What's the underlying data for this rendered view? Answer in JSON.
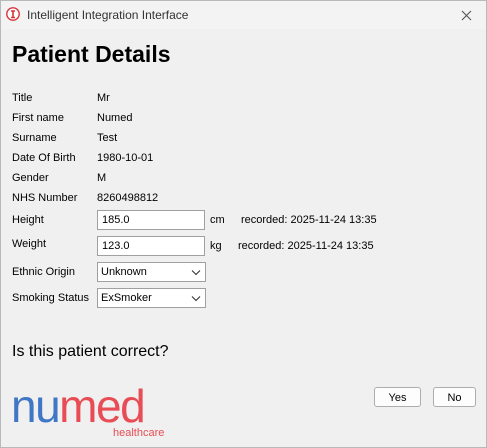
{
  "window": {
    "title": "Intelligent Integration Interface"
  },
  "page_title": "Patient Details",
  "fields": {
    "title": {
      "label": "Title",
      "value": "Mr"
    },
    "first_name": {
      "label": "First name",
      "value": "Numed"
    },
    "surname": {
      "label": "Surname",
      "value": "Test"
    },
    "dob": {
      "label": "Date Of Birth",
      "value": "1980-10-01"
    },
    "gender": {
      "label": "Gender",
      "value": "M"
    },
    "nhs_number": {
      "label": "NHS Number",
      "value": "8260498812"
    }
  },
  "height": {
    "label": "Height",
    "value": "185.0",
    "unit": "cm",
    "recorded": "recorded: 2025-11-24 13:35"
  },
  "weight": {
    "label": "Weight",
    "value": "123.0",
    "unit": "kg",
    "recorded": "recorded: 2025-11-24 13:35"
  },
  "ethnic_origin": {
    "label": "Ethnic Origin",
    "selected": "Unknown"
  },
  "smoking_status": {
    "label": "Smoking Status",
    "selected": "ExSmoker"
  },
  "question": "Is this patient correct?",
  "buttons": {
    "yes": "Yes",
    "no": "No"
  },
  "logo": {
    "brand_part1": "nu",
    "brand_part2": "med",
    "tagline": "healthcare"
  },
  "colors": {
    "brand_blue": "#3f77c6",
    "brand_red": "#e84d55",
    "app_icon_red": "#d8343b"
  }
}
